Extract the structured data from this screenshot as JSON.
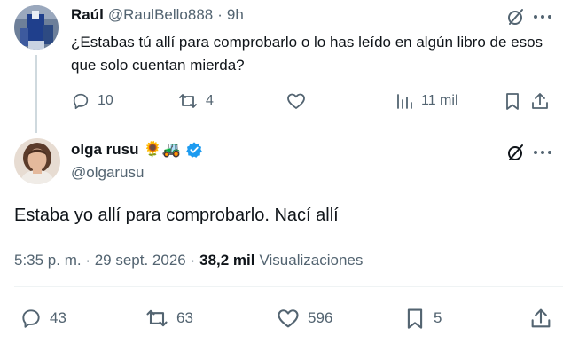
{
  "reply": {
    "name": "Raúl",
    "handle": "@RaulBello888",
    "dot": "·",
    "time": "9h",
    "text": "¿Estabas tú allí para comprobarlo o lo has leído en algún libro de esos que solo cuentan mierda?",
    "replies": "10",
    "reposts": "4",
    "views": "11 mil"
  },
  "main": {
    "name": "olga rusu",
    "emoji_badges": "🌻🚜",
    "handle": "@olgarusu",
    "text": "Estaba yo allí para comprobarlo. Nací allí",
    "timestamp": "5:35 p. m. · 29 sept. 2026 ·",
    "views_count": "38,2 mil",
    "views_label": "Visualizaciones",
    "replies": "43",
    "reposts": "63",
    "likes": "596",
    "bookmarks": "5"
  },
  "colors": {
    "text": "#0f1419",
    "secondary": "#536471",
    "verified": "#1d9bf0",
    "divider": "#eff3f4",
    "thread": "#cfd9de"
  },
  "icons": [
    "grok-icon",
    "more-icon",
    "reply-icon",
    "repost-icon",
    "like-icon",
    "views-icon",
    "bookmark-icon",
    "share-icon",
    "verified-badge-icon"
  ]
}
